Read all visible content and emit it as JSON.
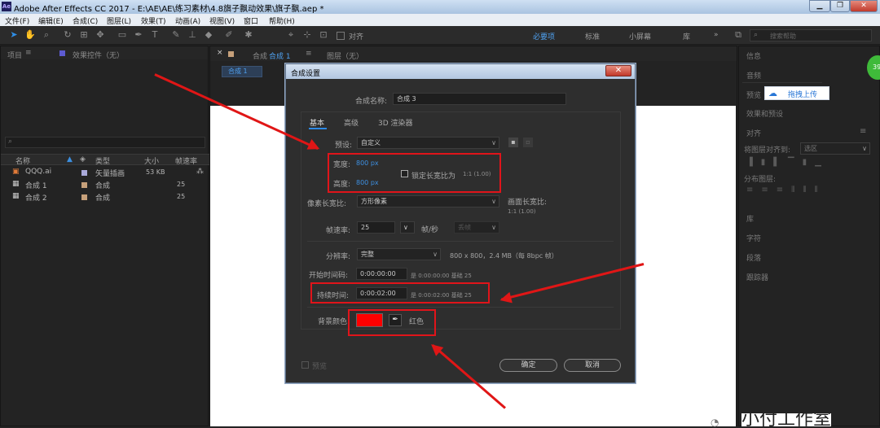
{
  "window": {
    "title": "Adobe After Effects CC 2017 - E:\\AE\\AE\\练习素材\\4.8旗子飘动效果\\旗子飘.aep *",
    "min": "▁",
    "max": "❐",
    "close": "✕"
  },
  "menu": [
    "文件(F)",
    "编辑(E)",
    "合成(C)",
    "图层(L)",
    "效果(T)",
    "动画(A)",
    "视图(V)",
    "窗口",
    "帮助(H)"
  ],
  "toolbar": {
    "align_label": "对齐",
    "workspaces": [
      "必要项",
      "标准",
      "小屏幕",
      "库"
    ],
    "overflow": "»",
    "search_placeholder": "搜索帮助"
  },
  "project": {
    "tab_label": "项目",
    "effects_tab": "效果控件（无）",
    "search_icon": "⌕",
    "columns": [
      "名称",
      "类型",
      "大小",
      "帧速率"
    ],
    "rows": [
      {
        "name": "QQQ.ai",
        "type": "矢量插画",
        "size": "53 KB",
        "fps": "",
        "color": "#a9a9d9"
      },
      {
        "name": "合成 1",
        "type": "合成",
        "size": "",
        "fps": "25",
        "color": "#c6a07a"
      },
      {
        "name": "合成 2",
        "type": "合成",
        "size": "",
        "fps": "25",
        "color": "#c6a07a"
      }
    ]
  },
  "composition": {
    "tab_label": "合成",
    "tab_name": "合成 1",
    "layer_tab": "图层（无）",
    "sub_tab": "合成 1"
  },
  "dialog": {
    "title": "合成设置",
    "close": "✕",
    "name_label": "合成名称:",
    "name_value": "合成 3",
    "tabs": [
      "基本",
      "高级",
      "3D 渲染器"
    ],
    "preset_label": "预设:",
    "preset_value": "自定义",
    "width_label": "宽度:",
    "width_value": "800 px",
    "height_label": "高度:",
    "height_value": "800 px",
    "lock_label": "锁定长宽比为",
    "lock_ratio": "1:1 (1.00)",
    "par_label": "像素长宽比:",
    "par_value": "方形像素",
    "frame_aspect_label": "画面长宽比:",
    "frame_aspect_value": "1:1 (1.00)",
    "fps_label": "帧速率:",
    "fps_value": "25",
    "fps_unit": "帧/秒",
    "fps_drop": "丢帧",
    "res_label": "分辨率:",
    "res_value": "完整",
    "res_info": "800 x 800，2.4 MB（每 8bpc 帧）",
    "start_label": "开始时间码:",
    "start_value": "0:00:00:00",
    "start_info": "是 0:00:00:00  基础 25",
    "dur_label": "持续时间:",
    "dur_value": "0:00:02:00",
    "dur_info": "是 0:00:02:00  基础 25",
    "bg_label": "背景颜色:",
    "bg_color": "#ff0000",
    "bg_name": "红色",
    "preview_label": "预览",
    "ok": "确定",
    "cancel": "取消"
  },
  "right_panel": {
    "items": [
      "信息",
      "音频",
      "预览",
      "效果和预设",
      "对齐",
      "库",
      "字符",
      "段落",
      "跟踪器"
    ],
    "align_to_label": "将图层对齐到:",
    "align_to_value": "选区",
    "distribute_label": "分布图层:",
    "upload_label": "拖拽上传",
    "badge": "39"
  },
  "watermark": "小付工作室"
}
